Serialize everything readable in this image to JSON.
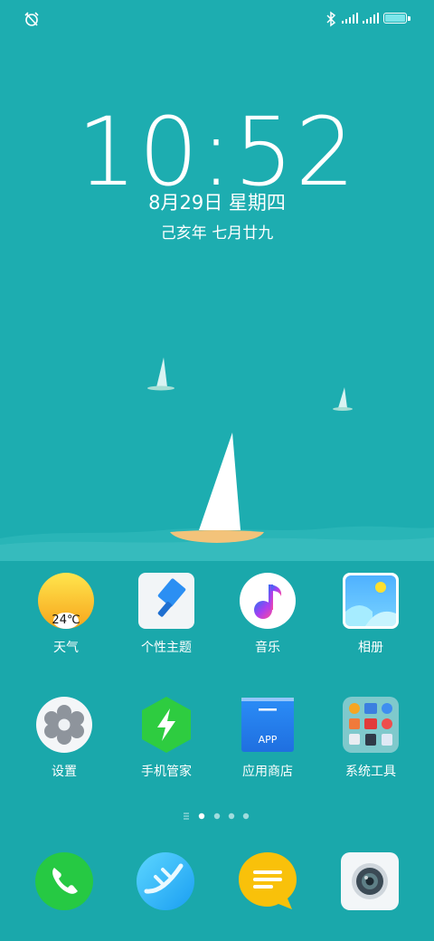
{
  "status_bar": {
    "icons": [
      "alarm-off-icon",
      "bluetooth-icon",
      "signal-icon",
      "signal-icon",
      "battery-icon"
    ]
  },
  "lockscreen": {
    "time": "10:52",
    "date": "8月29日 星期四",
    "lunar_date": "己亥年 七月廿九"
  },
  "home_row1": [
    {
      "label": "天气",
      "icon": "weather-icon",
      "badge": "24℃"
    },
    {
      "label": "个性主题",
      "icon": "theme-brush-icon"
    },
    {
      "label": "音乐",
      "icon": "music-note-icon"
    },
    {
      "label": "相册",
      "icon": "gallery-icon"
    }
  ],
  "home_row2": [
    {
      "label": "设置",
      "icon": "settings-gear-icon"
    },
    {
      "label": "手机管家",
      "icon": "phone-manager-icon"
    },
    {
      "label": "应用商店",
      "icon": "app-store-icon",
      "badge": "APP"
    },
    {
      "label": "系统工具",
      "icon": "system-tools-folder-icon"
    }
  ],
  "page_indicator": {
    "pages": 4,
    "current": 1
  },
  "dock": [
    {
      "icon": "phone-icon"
    },
    {
      "icon": "browser-icon"
    },
    {
      "icon": "messages-icon"
    },
    {
      "icon": "camera-icon"
    }
  ],
  "colors": {
    "background": "#1dadb0",
    "accent": "#ffffff"
  }
}
